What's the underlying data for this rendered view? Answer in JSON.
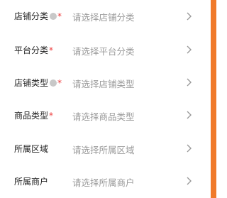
{
  "fields": [
    {
      "label": "店铺分类",
      "info": true,
      "required": "*",
      "placeholder": "请选择店铺分类"
    },
    {
      "label": "平台分类",
      "info": false,
      "required": "*",
      "placeholder": "请选择平台分类"
    },
    {
      "label": "店铺类型",
      "info": true,
      "required": "*",
      "placeholder": "请选择店铺类型"
    },
    {
      "label": "商品类型",
      "info": false,
      "required": "*",
      "placeholder": "请选择商品类型"
    },
    {
      "label": "所属区域",
      "info": false,
      "required": "",
      "placeholder": "请选择所属区域"
    },
    {
      "label": "所属商户",
      "info": false,
      "required": "",
      "placeholder": "请选择所属商户"
    }
  ],
  "colors": {
    "accent_edge": "#f07a2a",
    "required": "#ee3b3b",
    "placeholder": "#9a9a9a"
  },
  "icons": {
    "row_arrow": "chevron-right-icon",
    "info": "info-dot-icon"
  }
}
